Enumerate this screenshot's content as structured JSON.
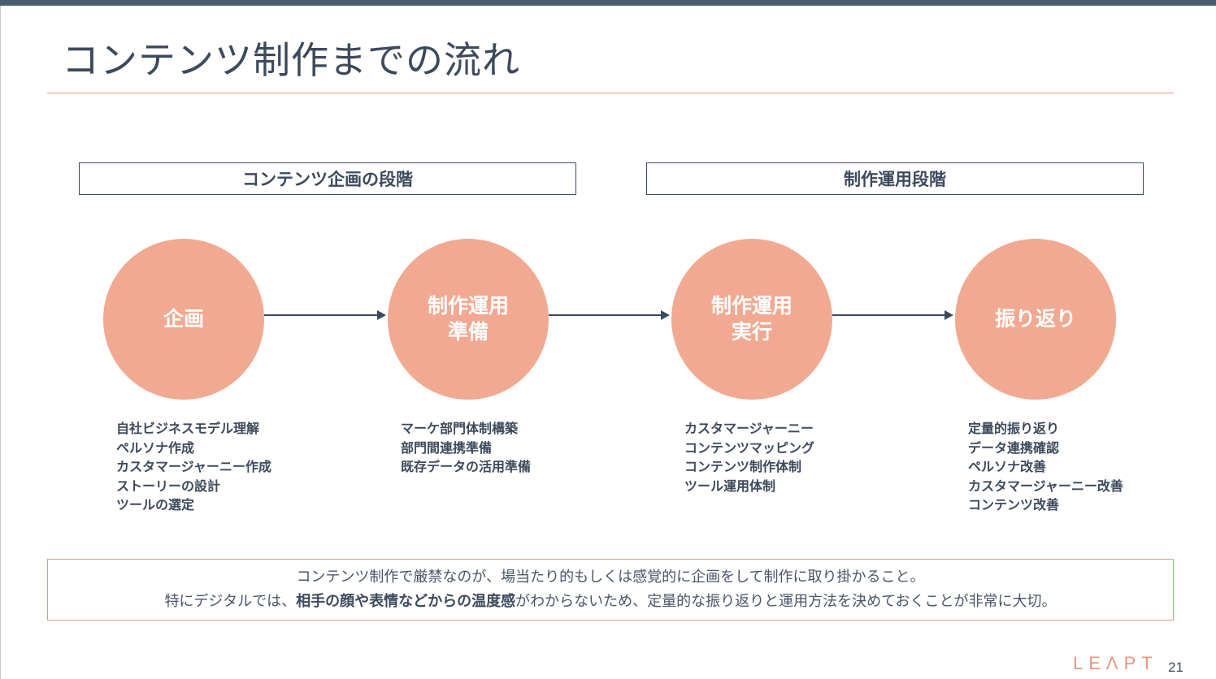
{
  "slide": {
    "title": "コンテンツ制作までの流れ",
    "page_number": "21",
    "logo_text": "LEΛPT"
  },
  "phases": [
    {
      "label": "コンテンツ企画の段階"
    },
    {
      "label": "制作運用段階"
    }
  ],
  "steps": [
    {
      "line1": "企画",
      "line2": ""
    },
    {
      "line1": "制作運用",
      "line2": "準備"
    },
    {
      "line1": "制作運用",
      "line2": "実行"
    },
    {
      "line1": "振り返り",
      "line2": ""
    }
  ],
  "details": [
    [
      "自社ビジネスモデル理解",
      "ペルソナ作成",
      "カスタマージャーニー作成",
      "ストーリーの設計",
      "ツールの選定"
    ],
    [
      "マーケ部門体制構築",
      "部門間連携準備",
      "既存データの活用準備"
    ],
    [
      "カスタマージャーニー",
      "コンテンツマッピング",
      "コンテンツ制作体制",
      "ツール運用体制"
    ],
    [
      "定量的振り返り",
      "データ連携確認",
      "ペルソナ改善",
      "カスタマージャーニー改善",
      "コンテンツ改善"
    ]
  ],
  "note": {
    "line1": "コンテンツ制作で厳禁なのが、場当たり的もしくは感覚的に企画をして制作に取り掛かること。",
    "line2_before": "特にデジタルでは、",
    "line2_bold": "相手の顔や表情などからの温度感",
    "line2_after": "がわからないため、定量的な振り返りと運用方法を決めておくことが非常に大切。"
  },
  "colors": {
    "circle_fill": "#f2a992",
    "accent": "#e8977e",
    "text": "#3d4a5c",
    "top_bar": "#4a5a70"
  }
}
